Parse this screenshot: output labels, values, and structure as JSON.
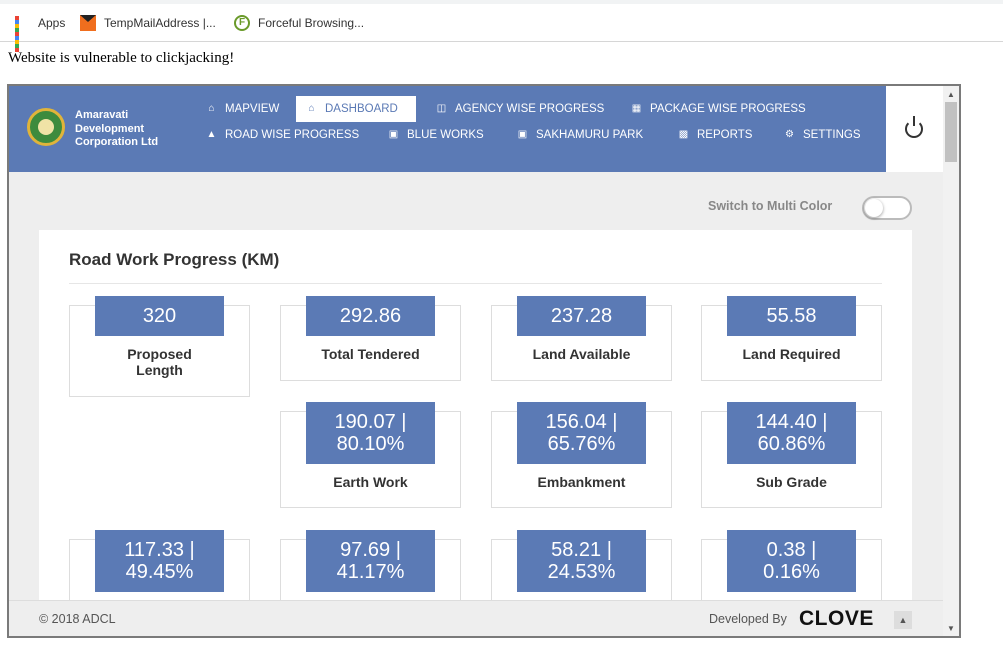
{
  "bookmarks": [
    {
      "label": "Apps",
      "icon": "apps-grid-icon"
    },
    {
      "label": "TempMailAddress |...",
      "icon": "mail-icon"
    },
    {
      "label": "Forceful Browsing...",
      "icon": "extension-icon"
    }
  ],
  "page": {
    "message": "Website is vulnerable to clickjacking!"
  },
  "header": {
    "brand": [
      "Amaravati",
      "Development",
      "Corporation Ltd"
    ],
    "nav": [
      {
        "label": "MAPVIEW",
        "icon": "home-icon",
        "active": false
      },
      {
        "label": "DASHBOARD",
        "icon": "home-icon",
        "active": true
      },
      {
        "label": "AGENCY WISE PROGRESS",
        "icon": "columns-icon",
        "active": false
      },
      {
        "label": "PACKAGE WISE PROGRESS",
        "icon": "grid-icon",
        "active": false
      },
      {
        "label": "ROAD WISE PROGRESS",
        "icon": "road-icon",
        "active": false
      },
      {
        "label": "BLUE WORKS",
        "icon": "image-icon",
        "active": false
      },
      {
        "label": "SAKHAMURU PARK",
        "icon": "image-icon",
        "active": false
      },
      {
        "label": "REPORTS",
        "icon": "bar-chart-icon",
        "active": false
      },
      {
        "label": "SETTINGS",
        "icon": "gear-icon",
        "active": false
      }
    ],
    "power_icon": "power-icon"
  },
  "toggle": {
    "label": "Switch to Multi Color",
    "on": false
  },
  "card": {
    "title": "Road Work Progress (KM)",
    "summary": [
      {
        "value": "320",
        "label": [
          "Proposed",
          "Length"
        ]
      },
      {
        "value": "292.86",
        "label": [
          "Total Tendered"
        ]
      },
      {
        "value": "237.28",
        "label": [
          "Land Available"
        ]
      },
      {
        "value": "55.58",
        "label": [
          "Land Required"
        ]
      }
    ],
    "progress": [
      {
        "line1": "190.07  |",
        "line2": "80.10%",
        "label": "Earth Work"
      },
      {
        "line1": "156.04  |",
        "line2": "65.76%",
        "label": "Embankment"
      },
      {
        "line1": "144.40  |",
        "line2": "60.86%",
        "label": "Sub Grade"
      }
    ],
    "bottom": [
      {
        "line1": "117.33  |",
        "line2": "49.45%"
      },
      {
        "line1": "97.69  |",
        "line2": "41.17%"
      },
      {
        "line1": "58.21  |",
        "line2": "24.53%"
      },
      {
        "line1": "0.38  |",
        "line2": "0.16%"
      }
    ]
  },
  "footer": {
    "copyright": "© 2018 ADCL",
    "developed_by": "Developed By",
    "company": "CLOVE"
  },
  "colors": {
    "accent": "#5b7ab5"
  }
}
